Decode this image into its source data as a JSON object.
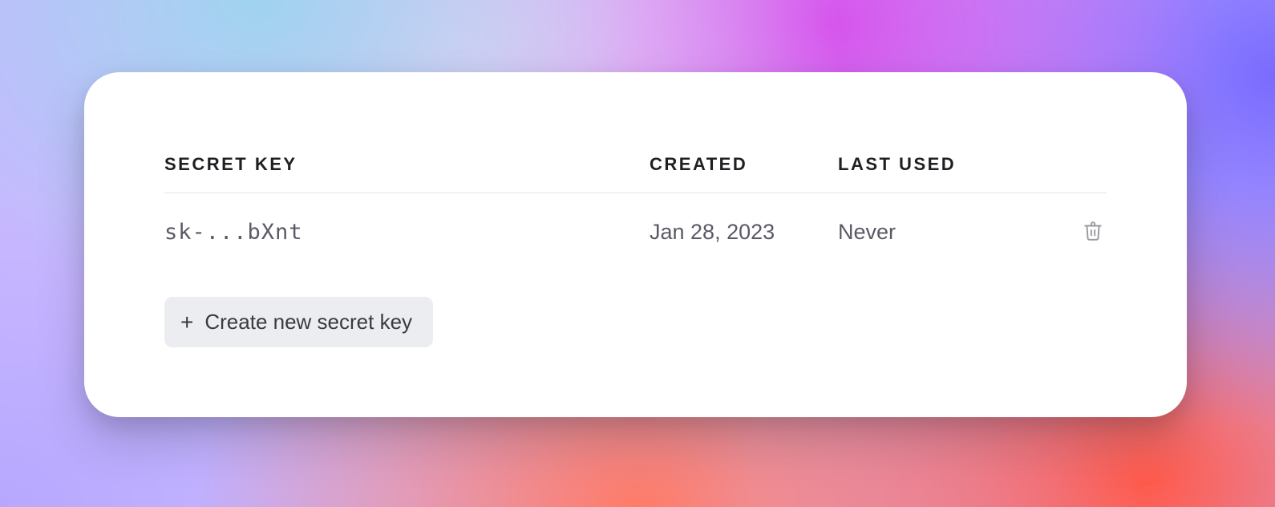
{
  "table": {
    "headers": {
      "secret_key": "SECRET KEY",
      "created": "CREATED",
      "last_used": "LAST USED"
    },
    "rows": [
      {
        "key": "sk-...bXnt",
        "created": "Jan 28, 2023",
        "last_used": "Never"
      }
    ]
  },
  "actions": {
    "create_label": "Create new secret key"
  }
}
